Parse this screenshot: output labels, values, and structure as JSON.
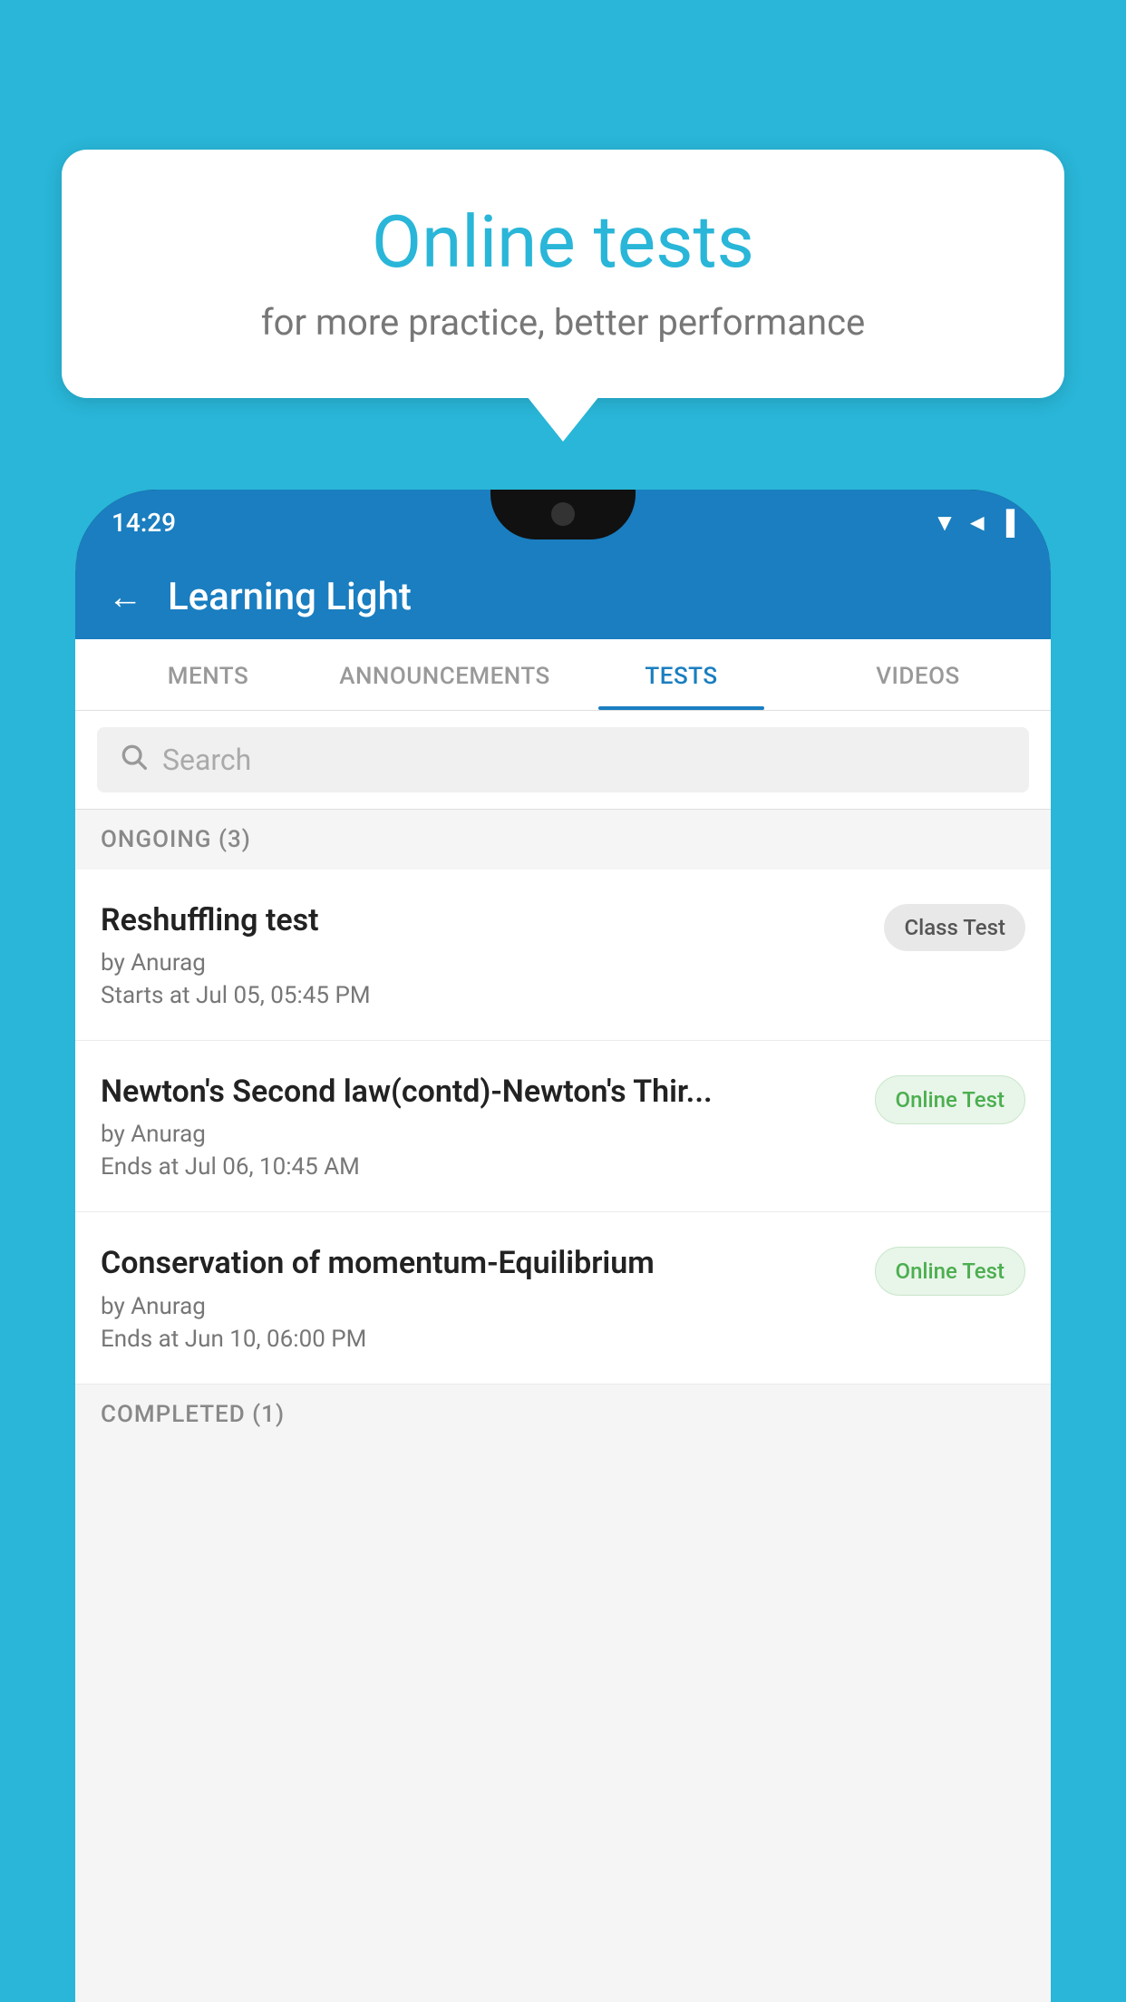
{
  "background": {
    "color": "#29b6d8"
  },
  "speech_bubble": {
    "title": "Online tests",
    "subtitle": "for more practice, better performance"
  },
  "phone": {
    "status_bar": {
      "time": "14:29",
      "icons": "▼◄▐"
    },
    "app_header": {
      "title": "Learning Light",
      "back_label": "←"
    },
    "tabs": [
      {
        "label": "MENTS",
        "active": false
      },
      {
        "label": "ANNOUNCEMENTS",
        "active": false
      },
      {
        "label": "TESTS",
        "active": true
      },
      {
        "label": "VIDEOS",
        "active": false
      }
    ],
    "search": {
      "placeholder": "Search"
    },
    "ongoing_section": {
      "label": "ONGOING (3)"
    },
    "test_items": [
      {
        "name": "Reshuffling test",
        "author": "by Anurag",
        "time_label": "Starts at",
        "time": "Jul 05, 05:45 PM",
        "badge": "Class Test",
        "badge_type": "class"
      },
      {
        "name": "Newton's Second law(contd)-Newton's Thir...",
        "author": "by Anurag",
        "time_label": "Ends at",
        "time": "Jul 06, 10:45 AM",
        "badge": "Online Test",
        "badge_type": "online"
      },
      {
        "name": "Conservation of momentum-Equilibrium",
        "author": "by Anurag",
        "time_label": "Ends at",
        "time": "Jun 10, 06:00 PM",
        "badge": "Online Test",
        "badge_type": "online"
      }
    ],
    "completed_section": {
      "label": "COMPLETED (1)"
    }
  }
}
